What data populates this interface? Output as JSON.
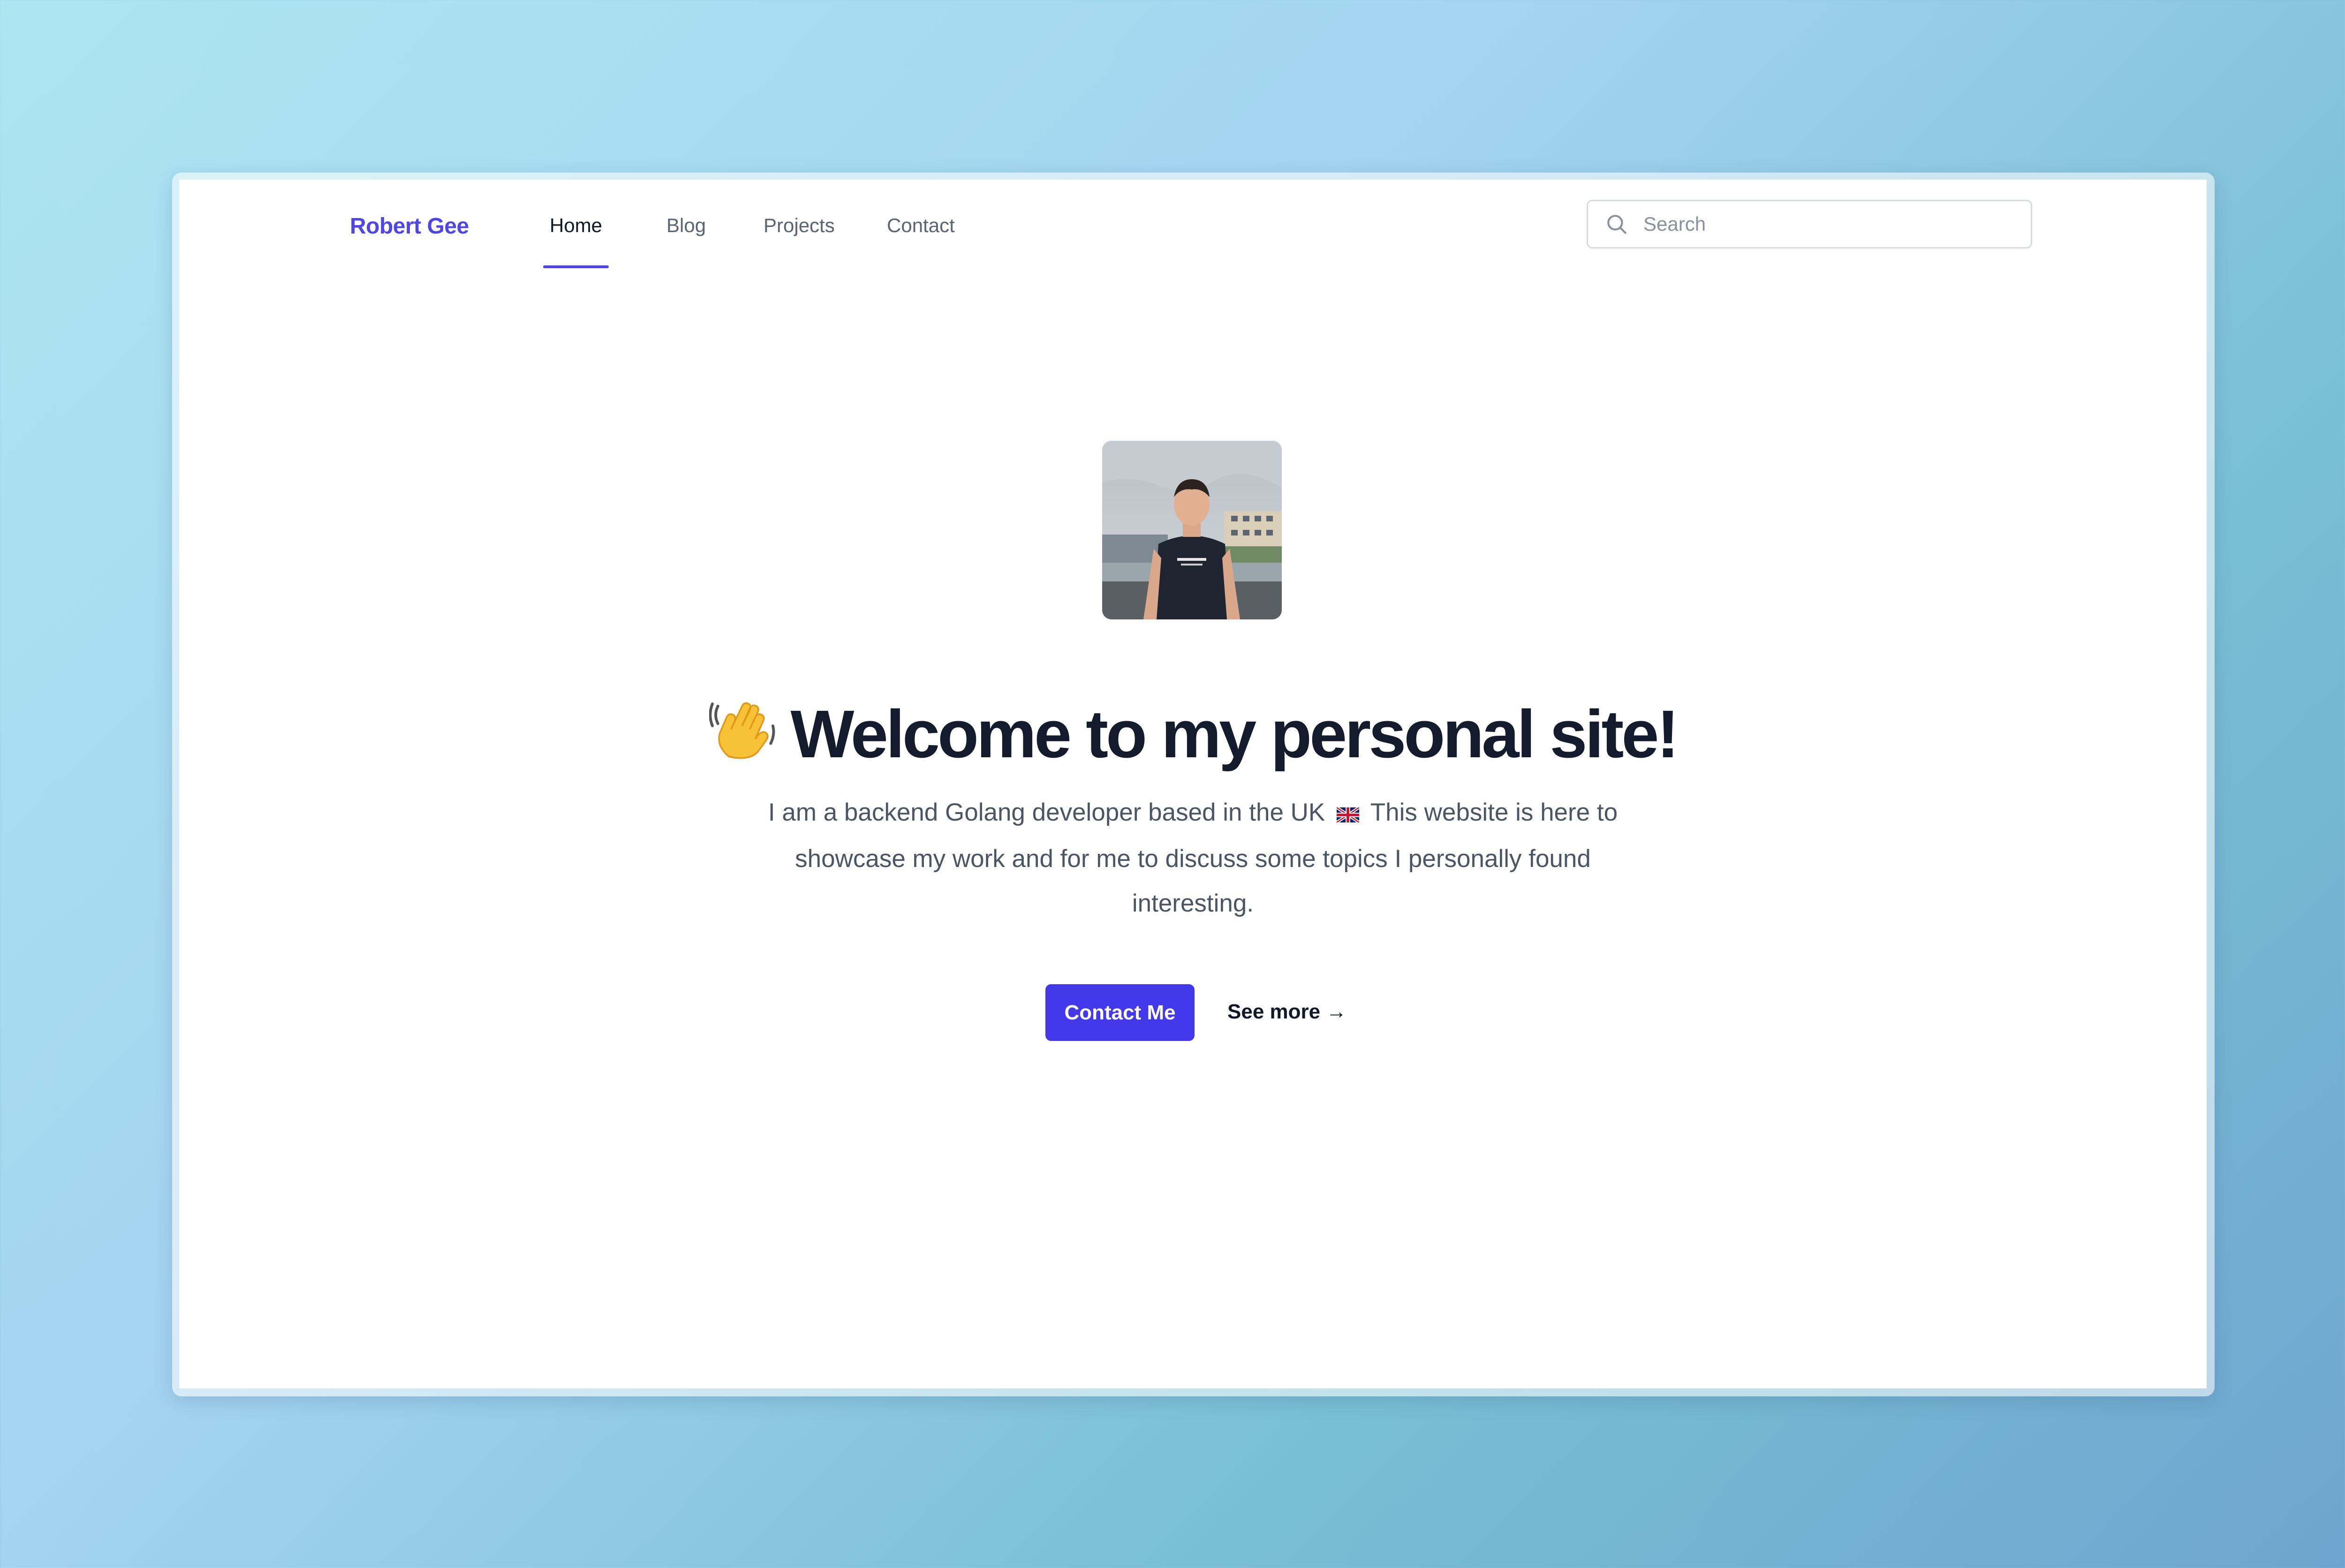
{
  "header": {
    "brand": "Robert Gee",
    "tabs": [
      {
        "label": "Home",
        "active": true
      },
      {
        "label": "Blog",
        "active": false
      },
      {
        "label": "Projects",
        "active": false
      },
      {
        "label": "Contact",
        "active": false
      }
    ],
    "search": {
      "placeholder": "Search",
      "value": "",
      "icon": "search-icon"
    }
  },
  "hero": {
    "avatar_icon": "profile-photo",
    "headline_emoji": "waving-hand-icon",
    "headline": "Welcome to my personal site!",
    "intro_part1": "I am a backend Golang developer based in the UK",
    "flag_icon": "uk-flag-icon",
    "intro_part2": "This website is here to showcase my work and for me to discuss some topics I personally found interesting.",
    "primary_button": "Contact Me",
    "secondary_link": "See more →"
  },
  "colors": {
    "accent": "#4f46e5",
    "button": "#4338ea",
    "heading": "#141b2d",
    "body_text": "#4b5563"
  }
}
